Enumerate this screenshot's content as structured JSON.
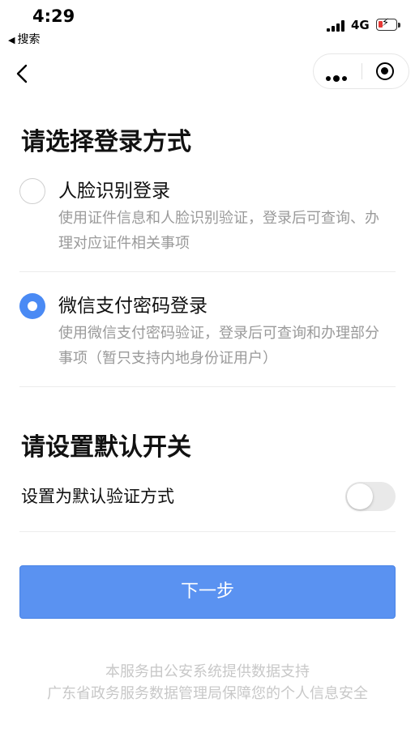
{
  "status_bar": {
    "time": "4:29",
    "back_app_label": "搜索",
    "network": "4G",
    "battery_color": "#e53935"
  },
  "nav": {
    "back_icon": "chevron-left-icon",
    "more_icon": "more-dots-icon",
    "close_icon": "target-circle-icon"
  },
  "login": {
    "title": "请选择登录方式",
    "options": [
      {
        "label": "人脸识别登录",
        "description": "使用证件信息和人脸识别验证，登录后可查询、办理对应证件相关事项",
        "selected": false
      },
      {
        "label": "微信支付密码登录",
        "description": "使用微信支付密码验证，登录后可查询和办理部分事项（暂只支持内地身份证用户）",
        "selected": true
      }
    ]
  },
  "default_setting": {
    "title": "请设置默认开关",
    "label": "设置为默认验证方式",
    "enabled": false
  },
  "next_button": {
    "label": "下一步",
    "color": "#5a92f1"
  },
  "footer": {
    "line1": "本服务由公安系统提供数据支持",
    "line2": "广东省政务服务数据管理局保障您的个人信息安全"
  }
}
